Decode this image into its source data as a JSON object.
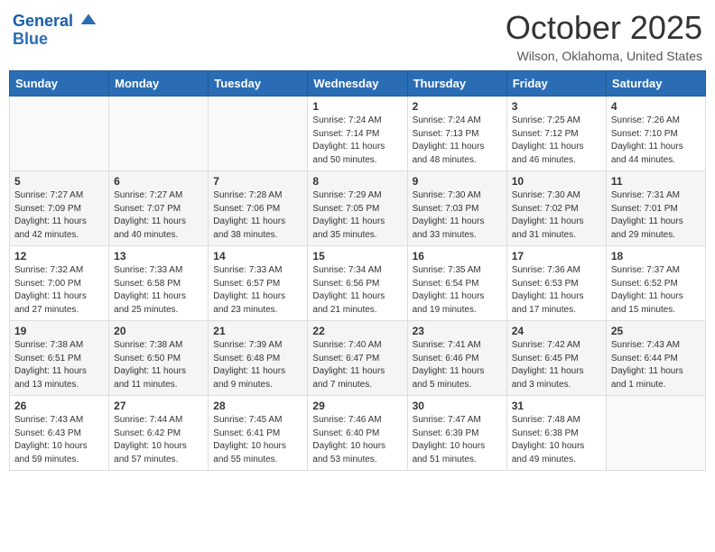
{
  "header": {
    "logo_line1": "General",
    "logo_line2": "Blue",
    "month": "October 2025",
    "location": "Wilson, Oklahoma, United States"
  },
  "weekdays": [
    "Sunday",
    "Monday",
    "Tuesday",
    "Wednesday",
    "Thursday",
    "Friday",
    "Saturday"
  ],
  "weeks": [
    [
      {
        "day": "",
        "detail": ""
      },
      {
        "day": "",
        "detail": ""
      },
      {
        "day": "",
        "detail": ""
      },
      {
        "day": "1",
        "detail": "Sunrise: 7:24 AM\nSunset: 7:14 PM\nDaylight: 11 hours\nand 50 minutes."
      },
      {
        "day": "2",
        "detail": "Sunrise: 7:24 AM\nSunset: 7:13 PM\nDaylight: 11 hours\nand 48 minutes."
      },
      {
        "day": "3",
        "detail": "Sunrise: 7:25 AM\nSunset: 7:12 PM\nDaylight: 11 hours\nand 46 minutes."
      },
      {
        "day": "4",
        "detail": "Sunrise: 7:26 AM\nSunset: 7:10 PM\nDaylight: 11 hours\nand 44 minutes."
      }
    ],
    [
      {
        "day": "5",
        "detail": "Sunrise: 7:27 AM\nSunset: 7:09 PM\nDaylight: 11 hours\nand 42 minutes."
      },
      {
        "day": "6",
        "detail": "Sunrise: 7:27 AM\nSunset: 7:07 PM\nDaylight: 11 hours\nand 40 minutes."
      },
      {
        "day": "7",
        "detail": "Sunrise: 7:28 AM\nSunset: 7:06 PM\nDaylight: 11 hours\nand 38 minutes."
      },
      {
        "day": "8",
        "detail": "Sunrise: 7:29 AM\nSunset: 7:05 PM\nDaylight: 11 hours\nand 35 minutes."
      },
      {
        "day": "9",
        "detail": "Sunrise: 7:30 AM\nSunset: 7:03 PM\nDaylight: 11 hours\nand 33 minutes."
      },
      {
        "day": "10",
        "detail": "Sunrise: 7:30 AM\nSunset: 7:02 PM\nDaylight: 11 hours\nand 31 minutes."
      },
      {
        "day": "11",
        "detail": "Sunrise: 7:31 AM\nSunset: 7:01 PM\nDaylight: 11 hours\nand 29 minutes."
      }
    ],
    [
      {
        "day": "12",
        "detail": "Sunrise: 7:32 AM\nSunset: 7:00 PM\nDaylight: 11 hours\nand 27 minutes."
      },
      {
        "day": "13",
        "detail": "Sunrise: 7:33 AM\nSunset: 6:58 PM\nDaylight: 11 hours\nand 25 minutes."
      },
      {
        "day": "14",
        "detail": "Sunrise: 7:33 AM\nSunset: 6:57 PM\nDaylight: 11 hours\nand 23 minutes."
      },
      {
        "day": "15",
        "detail": "Sunrise: 7:34 AM\nSunset: 6:56 PM\nDaylight: 11 hours\nand 21 minutes."
      },
      {
        "day": "16",
        "detail": "Sunrise: 7:35 AM\nSunset: 6:54 PM\nDaylight: 11 hours\nand 19 minutes."
      },
      {
        "day": "17",
        "detail": "Sunrise: 7:36 AM\nSunset: 6:53 PM\nDaylight: 11 hours\nand 17 minutes."
      },
      {
        "day": "18",
        "detail": "Sunrise: 7:37 AM\nSunset: 6:52 PM\nDaylight: 11 hours\nand 15 minutes."
      }
    ],
    [
      {
        "day": "19",
        "detail": "Sunrise: 7:38 AM\nSunset: 6:51 PM\nDaylight: 11 hours\nand 13 minutes."
      },
      {
        "day": "20",
        "detail": "Sunrise: 7:38 AM\nSunset: 6:50 PM\nDaylight: 11 hours\nand 11 minutes."
      },
      {
        "day": "21",
        "detail": "Sunrise: 7:39 AM\nSunset: 6:48 PM\nDaylight: 11 hours\nand 9 minutes."
      },
      {
        "day": "22",
        "detail": "Sunrise: 7:40 AM\nSunset: 6:47 PM\nDaylight: 11 hours\nand 7 minutes."
      },
      {
        "day": "23",
        "detail": "Sunrise: 7:41 AM\nSunset: 6:46 PM\nDaylight: 11 hours\nand 5 minutes."
      },
      {
        "day": "24",
        "detail": "Sunrise: 7:42 AM\nSunset: 6:45 PM\nDaylight: 11 hours\nand 3 minutes."
      },
      {
        "day": "25",
        "detail": "Sunrise: 7:43 AM\nSunset: 6:44 PM\nDaylight: 11 hours\nand 1 minute."
      }
    ],
    [
      {
        "day": "26",
        "detail": "Sunrise: 7:43 AM\nSunset: 6:43 PM\nDaylight: 10 hours\nand 59 minutes."
      },
      {
        "day": "27",
        "detail": "Sunrise: 7:44 AM\nSunset: 6:42 PM\nDaylight: 10 hours\nand 57 minutes."
      },
      {
        "day": "28",
        "detail": "Sunrise: 7:45 AM\nSunset: 6:41 PM\nDaylight: 10 hours\nand 55 minutes."
      },
      {
        "day": "29",
        "detail": "Sunrise: 7:46 AM\nSunset: 6:40 PM\nDaylight: 10 hours\nand 53 minutes."
      },
      {
        "day": "30",
        "detail": "Sunrise: 7:47 AM\nSunset: 6:39 PM\nDaylight: 10 hours\nand 51 minutes."
      },
      {
        "day": "31",
        "detail": "Sunrise: 7:48 AM\nSunset: 6:38 PM\nDaylight: 10 hours\nand 49 minutes."
      },
      {
        "day": "",
        "detail": ""
      }
    ]
  ]
}
